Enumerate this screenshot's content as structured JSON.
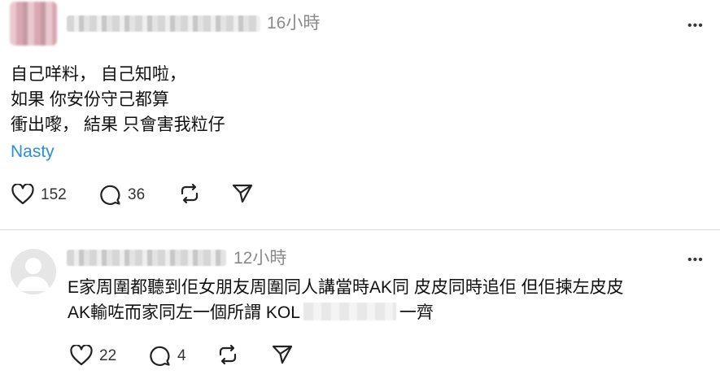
{
  "post": {
    "timestamp": "16小時",
    "more_label": "•••",
    "lines": [
      "自己咩料， 自己知啦，",
      "如果 你安份守己都算",
      "衝出嚟， 結果 只會害我粒仔"
    ],
    "tag": "Nasty",
    "likes": "152",
    "comments": "36"
  },
  "reply": {
    "timestamp": "12小時",
    "more_label": "•••",
    "line1": "E家周圍都聽到佢女朋友周圍同人講當時AK同 皮皮同時追佢 但佢揀左皮皮",
    "line2_pre": "AK輸咗而家同左一個所謂 KOL",
    "line2_post": "一齊",
    "likes": "22",
    "comments": "4"
  },
  "icons": {
    "like": "heart-icon",
    "comment": "comment-bubble-icon",
    "repost": "repost-icon",
    "share": "send-icon",
    "more": "more-options-icon"
  },
  "colors": {
    "link": "#2b8fd6",
    "muted": "#8a8a8a",
    "divider": "#dcdcdc"
  }
}
